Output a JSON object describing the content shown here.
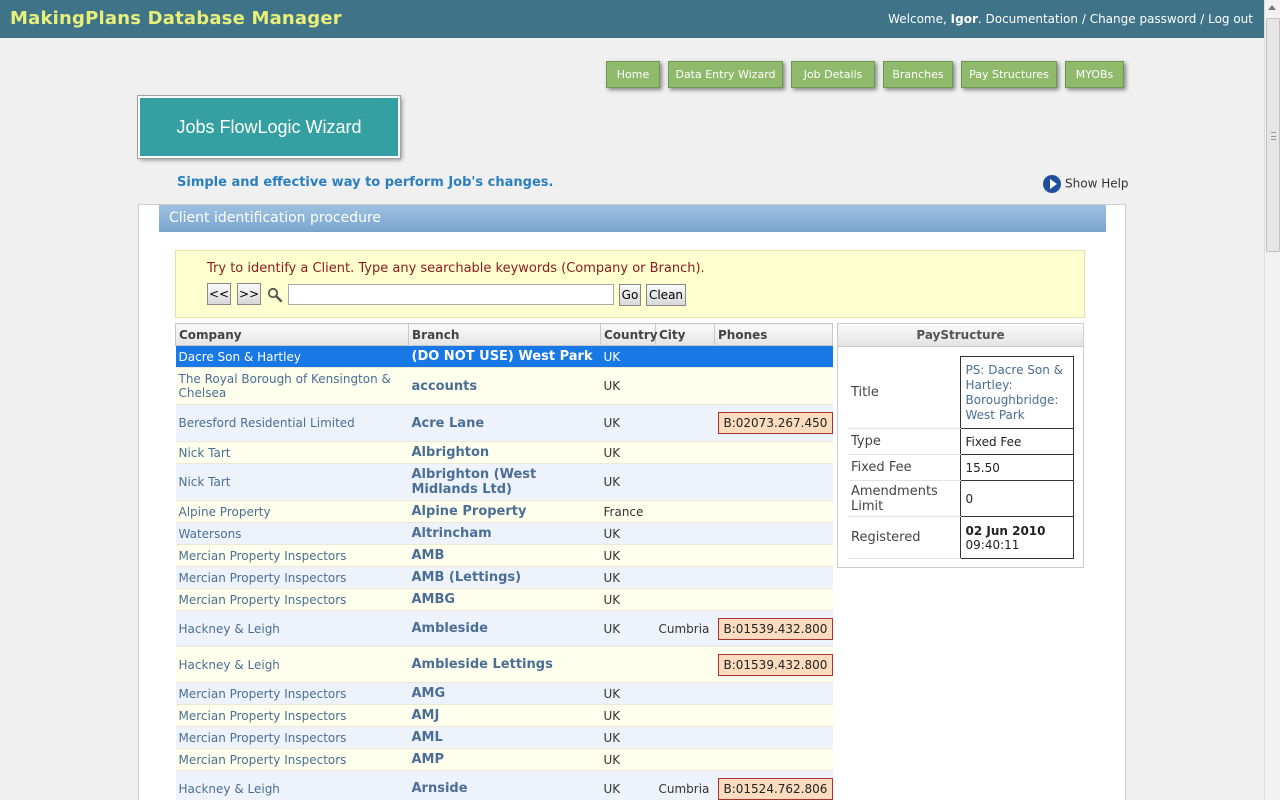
{
  "app": {
    "title": "MakingPlans Database Manager",
    "welcome_prefix": "Welcome, ",
    "user": "Igor",
    "welcome_suffix": ". ",
    "links": {
      "documentation": "Documentation",
      "sep1": " / ",
      "change_password": "Change password",
      "sep2": " / ",
      "logout": "Log out"
    }
  },
  "nav": {
    "home": "Home",
    "data_entry_wizard": "Data Entry Wizard",
    "job_details": "Job Details",
    "branches": "Branches",
    "pay_structures": "Pay Structures",
    "myobs": "MYOBs"
  },
  "wizard": {
    "title": "Jobs FlowLogic Wizard",
    "subtitle": "Simple and effective way to perform Job's changes.",
    "show_help": "Show Help"
  },
  "panel": {
    "header": "Client identification procedure"
  },
  "search": {
    "hint": "Try to identify a Client. Type any searchable keywords (Company or Branch).",
    "prev": "<<",
    "next": ">>",
    "value": "",
    "go": "Go",
    "clean": "Clean"
  },
  "table": {
    "headers": {
      "company": "Company",
      "branch": "Branch",
      "country": "Country",
      "city": "City",
      "phones": "Phones"
    },
    "rows": [
      {
        "company": "Dacre Son & Hartley",
        "branch": "(DO NOT USE) West Park",
        "country": "UK",
        "city": "",
        "phone": ""
      },
      {
        "company": "The Royal Borough of Kensington & Chelsea",
        "branch": "accounts",
        "country": "UK",
        "city": "",
        "phone": ""
      },
      {
        "company": "Beresford Residential Limited",
        "branch": "Acre Lane",
        "country": "UK",
        "city": "",
        "phone": "B:02073.267.450"
      },
      {
        "company": "Nick Tart",
        "branch": "Albrighton",
        "country": "UK",
        "city": "",
        "phone": ""
      },
      {
        "company": "Nick Tart",
        "branch": "Albrighton (West Midlands Ltd)",
        "country": "UK",
        "city": "",
        "phone": ""
      },
      {
        "company": "Alpine Property",
        "branch": "Alpine Property",
        "country": "France",
        "city": "",
        "phone": ""
      },
      {
        "company": "Watersons",
        "branch": "Altrincham",
        "country": "UK",
        "city": "",
        "phone": ""
      },
      {
        "company": "Mercian Property Inspectors",
        "branch": "AMB",
        "country": "UK",
        "city": "",
        "phone": ""
      },
      {
        "company": "Mercian Property Inspectors",
        "branch": "AMB (Lettings)",
        "country": "UK",
        "city": "",
        "phone": ""
      },
      {
        "company": "Mercian Property Inspectors",
        "branch": "AMBG",
        "country": "UK",
        "city": "",
        "phone": ""
      },
      {
        "company": "Hackney & Leigh",
        "branch": "Ambleside",
        "country": "UK",
        "city": "Cumbria",
        "phone": "B:01539.432.800"
      },
      {
        "company": "Hackney & Leigh",
        "branch": "Ambleside Lettings",
        "country": "",
        "city": "",
        "phone": "B:01539.432.800"
      },
      {
        "company": "Mercian Property Inspectors",
        "branch": "AMG",
        "country": "UK",
        "city": "",
        "phone": ""
      },
      {
        "company": "Mercian Property Inspectors",
        "branch": "AMJ",
        "country": "UK",
        "city": "",
        "phone": ""
      },
      {
        "company": "Mercian Property Inspectors",
        "branch": "AML",
        "country": "UK",
        "city": "",
        "phone": ""
      },
      {
        "company": "Mercian Property Inspectors",
        "branch": "AMP",
        "country": "UK",
        "city": "",
        "phone": ""
      },
      {
        "company": "Hackney & Leigh",
        "branch": "Arnside",
        "country": "UK",
        "city": "Cumbria",
        "phone": "B:01524.762.806"
      }
    ]
  },
  "pay_structure": {
    "heading": "PayStructure",
    "labels": {
      "title": "Title",
      "type": "Type",
      "fixed_fee": "Fixed Fee",
      "amendments_limit": "Amendments Limit",
      "registered": "Registered"
    },
    "values": {
      "title": "PS: Dacre Son & Hartley: Boroughbridge: West Park",
      "type": "Fixed Fee",
      "fixed_fee": "15.50",
      "amendments_limit": "0",
      "registered_date": "02 Jun 2010",
      "registered_time": "09:40:11"
    }
  }
}
